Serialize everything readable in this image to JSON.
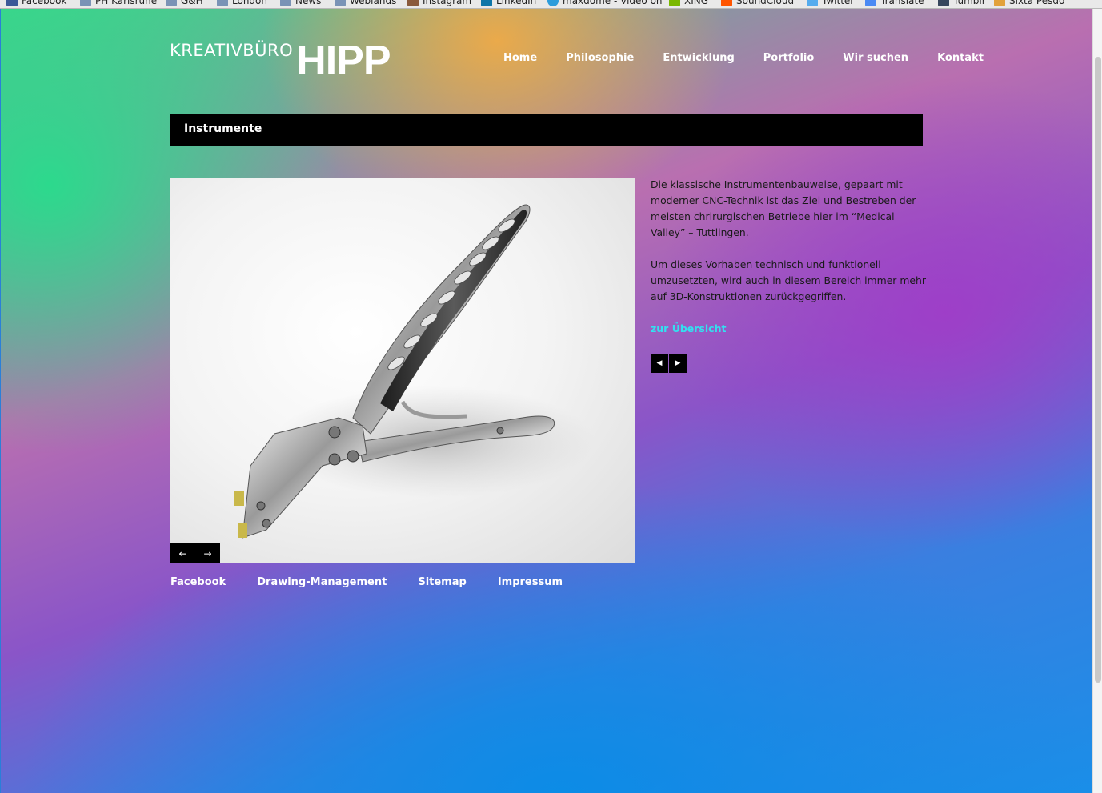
{
  "browser": {
    "bookmarks": [
      {
        "label": "Facebook",
        "icon": "facebook-icon",
        "color": "#3b5998"
      },
      {
        "label": "PH Karlsruhe",
        "icon": "folder-icon",
        "color": "#7a93b6"
      },
      {
        "label": "G&H",
        "icon": "folder-icon",
        "color": "#7a93b6"
      },
      {
        "label": "London",
        "icon": "folder-icon",
        "color": "#7a93b6"
      },
      {
        "label": "News",
        "icon": "folder-icon",
        "color": "#7a93b6"
      },
      {
        "label": "Weblands",
        "icon": "folder-icon",
        "color": "#7a93b6"
      },
      {
        "label": "Instagram",
        "icon": "instagram-icon",
        "color": "#8a5a3c"
      },
      {
        "label": "LinkedIn",
        "icon": "linkedin-icon",
        "color": "#0e76a8"
      },
      {
        "label": "maxdome - Video on",
        "icon": "maxdome-icon",
        "color": "#2d9cdb"
      },
      {
        "label": "XING",
        "icon": "xing-icon",
        "color": "#7ab800"
      },
      {
        "label": "SoundCloud",
        "icon": "soundcloud-icon",
        "color": "#ff5500"
      },
      {
        "label": "Twitter",
        "icon": "twitter-icon",
        "color": "#55acee"
      },
      {
        "label": "Translate",
        "icon": "translate-icon",
        "color": "#4a8af4"
      },
      {
        "label": "Tumblr",
        "icon": "tumblr-icon",
        "color": "#36465d"
      },
      {
        "label": "Sixta Pesdo",
        "icon": "bookmark-icon",
        "color": "#e2a23b"
      }
    ]
  },
  "logo": {
    "thin": "KREATIVBÜRO",
    "bold": "HIPP"
  },
  "nav": {
    "items": [
      "Home",
      "Philosophie",
      "Entwicklung",
      "Portfolio",
      "Wir suchen",
      "Kontakt"
    ]
  },
  "title": "Instrumente",
  "image": {
    "alt_icon": "surgical-pliers-illustration"
  },
  "slider": {
    "prev": "←",
    "next": "→"
  },
  "content": {
    "paragraph1": "Die klassische Instrumentenbauweise, gepaart mit moderner CNC-Technik ist das Ziel und Bestreben der meisten chrirurgischen Betriebe hier im “Medical Valley” – Tuttlingen.",
    "paragraph2": "Um dieses Vorhaben technisch und funktionell umzusetzten, wird auch in diesem Bereich immer mehr auf 3D-Konstruktionen zurückgegriffen.",
    "overview_link": "zur Übersicht",
    "prev_arrow": "◀",
    "next_arrow": "▶"
  },
  "footer": {
    "links": [
      "Facebook",
      "Drawing-Management",
      "Sitemap",
      "Impressum"
    ]
  },
  "colors": {
    "link_accent": "#33e0f0",
    "bar": "#000000"
  }
}
